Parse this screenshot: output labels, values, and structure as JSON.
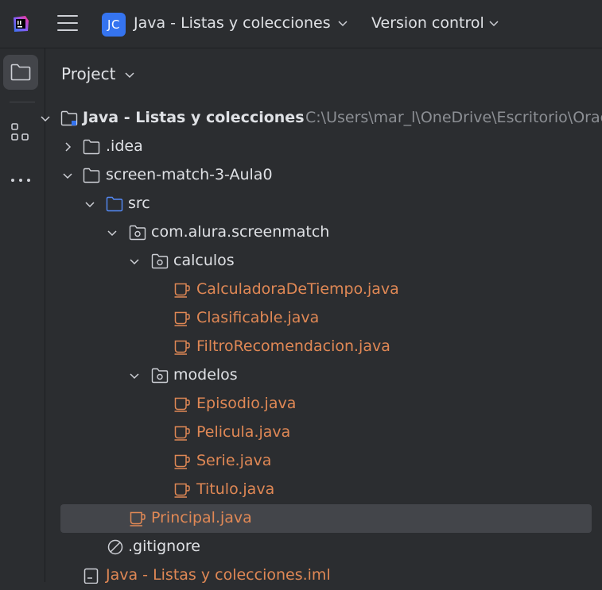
{
  "header": {
    "project_initials": "JC",
    "project_name": "Java - Listas y colecciones",
    "vcs_label": "Version control"
  },
  "panel": {
    "title": "Project"
  },
  "tree": {
    "root": {
      "label": "Java - Listas y colecciones",
      "path": "C:\\Users\\mar_l\\OneDrive\\Escritorio\\Orac"
    },
    "idea": {
      "label": ".idea"
    },
    "module": {
      "label": "screen-match-3-Aula0"
    },
    "src": {
      "label": "src"
    },
    "pkg": {
      "label": "com.alura.screenmatch"
    },
    "calculos": {
      "label": "calculos"
    },
    "calc_files": [
      "CalculadoraDeTiempo.java",
      "Clasificable.java",
      "FiltroRecomendacion.java"
    ],
    "modelos": {
      "label": "modelos"
    },
    "model_files": [
      "Episodio.java",
      "Pelicula.java",
      "Serie.java",
      "Titulo.java"
    ],
    "principal": {
      "label": "Principal.java"
    },
    "gitignore": {
      "label": ".gitignore"
    },
    "iml": {
      "label": "Java - Listas y colecciones.iml"
    }
  },
  "colors": {
    "background": "#2b2d30",
    "selection": "#43454a",
    "accent": "#3574f0",
    "java_file": "#e08855",
    "path_text": "#8c8f94"
  },
  "icons": {
    "logo": "intellij-logo-icon",
    "menu": "hamburger-menu-icon",
    "project_tool": "folder-icon",
    "structure_tool": "structure-icon",
    "more_tools": "more-horizontal-icon"
  }
}
